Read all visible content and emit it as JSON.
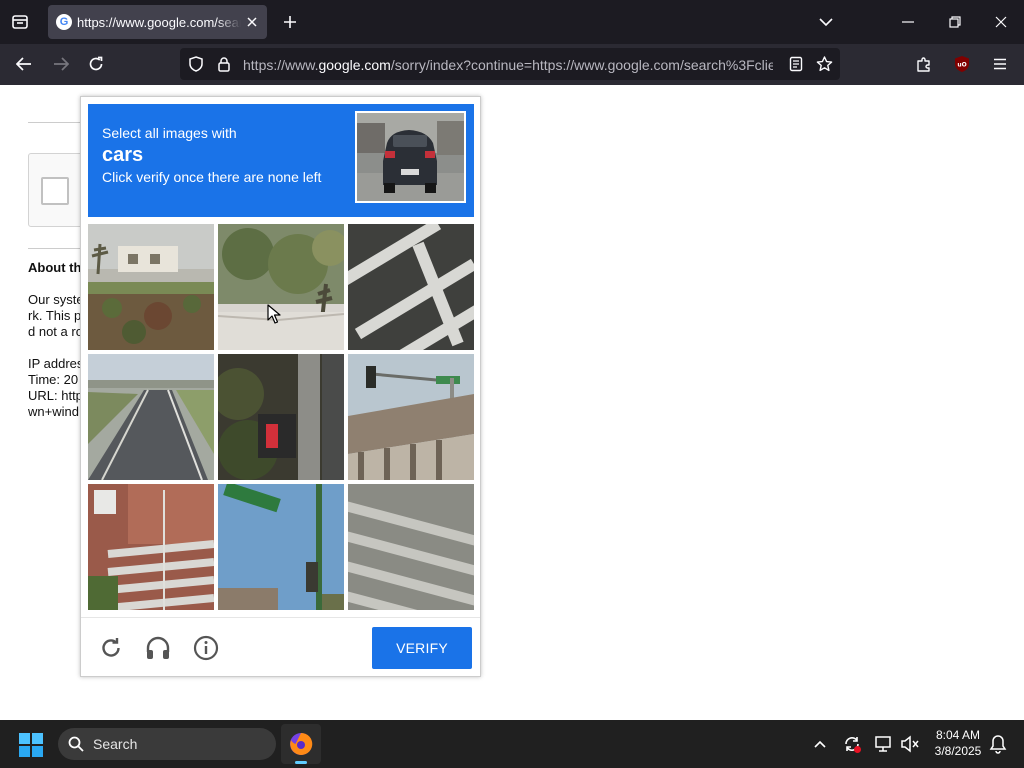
{
  "browser": {
    "tab_title": "https://www.google.com/search?q=",
    "url_prefix": "https://www.",
    "url_host": "google.com",
    "url_rest": "/sorry/index?continue=https://www.google.com/search%3Fclie",
    "accent_color": "#1c1b22"
  },
  "background_page": {
    "about_heading": "About th",
    "line1": "Our syste",
    "line2": "rk. This p",
    "line3": "d not a ro",
    "ip_label": "IP addres",
    "time_label": "Time: 20",
    "url_label": "URL: http",
    "url_cont": "wn+wind"
  },
  "captcha": {
    "instruction_line1": "Select all images with",
    "target_object": "cars",
    "instruction_line3": "Click verify once there are none left",
    "verify_label": "VERIFY",
    "header_color": "#1a73e8",
    "tiles": [
      {
        "name": "palm-yard"
      },
      {
        "name": "shrubs-sidewalk"
      },
      {
        "name": "road-markings"
      },
      {
        "name": "highway"
      },
      {
        "name": "traffic-signal-pole"
      },
      {
        "name": "bridge-with-signal"
      },
      {
        "name": "stairs"
      },
      {
        "name": "street-sign"
      },
      {
        "name": "crosswalk-stripes"
      }
    ]
  },
  "taskbar": {
    "search_label": "Search",
    "time": "8:04 AM",
    "date": "3/8/2025"
  }
}
